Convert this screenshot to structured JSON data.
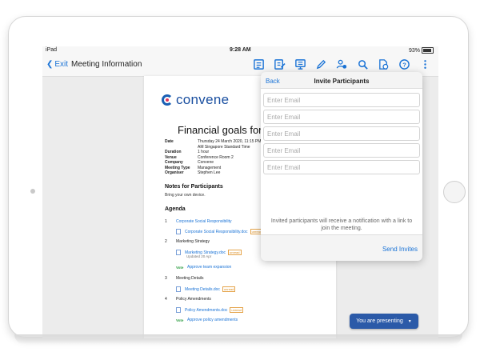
{
  "status_bar": {
    "device": "iPad",
    "time": "9:28 AM",
    "battery": "93%"
  },
  "nav": {
    "back_label": "Exit",
    "title": "Meeting Information",
    "icons": [
      "list-icon",
      "edit-document-icon",
      "present-screen-icon",
      "pencil-icon",
      "users-icon",
      "search-icon",
      "document-lock-icon",
      "help-icon",
      "more-icon"
    ]
  },
  "document": {
    "logo_text": "convene",
    "title": "Financial goals for the",
    "meta": [
      {
        "k": "Date",
        "v": "Thursday 24 March 2020, 11:15 PM"
      },
      {
        "k": "",
        "v": "AM Singapore Standard Time"
      },
      {
        "k": "Duration",
        "v": "1 hour"
      },
      {
        "k": "Venue",
        "v": "Conference Room 2"
      },
      {
        "k": "Company",
        "v": "Convene"
      },
      {
        "k": "Meeting Type",
        "v": "Management"
      },
      {
        "k": "Organiser",
        "v": "Stephen Lee"
      }
    ],
    "notes_heading": "Notes for Participants",
    "notes_text": "Bring your own device.",
    "agenda_heading": "Agenda",
    "agenda": {
      "i1_num": "1",
      "i1_title": "Corporate Social Responsibility",
      "i1_doc": "Corporate Social Responsibility.doc",
      "i1_tag": "unread",
      "i2_num": "2",
      "i2_title": "Marketing Strategy",
      "i2_doc": "Marketing Strategy.doc",
      "i2_tag": "unread",
      "i2_updated": "Updated 20 Apr",
      "i2_vote": "Vote",
      "i2_vote_text": "Approve team expansion",
      "i3_num": "3",
      "i3_title": "Meeting Details",
      "i3_doc": "Meeting Details.doc",
      "i3_tag": "unread",
      "i4_num": "4",
      "i4_title": "Policy Amendments",
      "i4_doc": "Policy Amendments.doc",
      "i4_tag": "unread",
      "i4_vote": "Vote",
      "i4_vote_text": "Approve policy amendments"
    }
  },
  "popover": {
    "back_label": "Back",
    "title": "Invite Participants",
    "email_placeholder": "Enter Email",
    "emails": [
      "",
      "",
      "",
      "",
      ""
    ],
    "note": "Invited participants will receive a notification with a link to join the meeting.",
    "send_label": "Send Invites"
  },
  "present_button": {
    "label": "You are presenting"
  },
  "colors": {
    "accent": "#1a73d6",
    "present": "#2b5aa8",
    "logo": "#1a4fa0"
  }
}
